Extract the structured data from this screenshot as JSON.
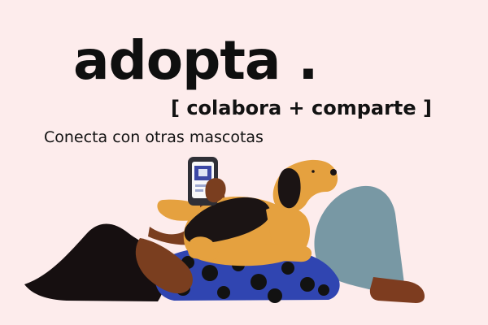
{
  "hero": {
    "headline": "adopta .",
    "subheadline": "[ colabora + comparte ]",
    "tagline": "Conecta con otras mascotas"
  },
  "colors": {
    "background": "#fdecec",
    "text": "#111111",
    "dog": "#e5a13f",
    "dog_dark": "#1a1414",
    "skin": "#7a3e1e",
    "jeans": "#7395a4",
    "shirt": "#3043a9",
    "phone": "#2f2f36"
  }
}
